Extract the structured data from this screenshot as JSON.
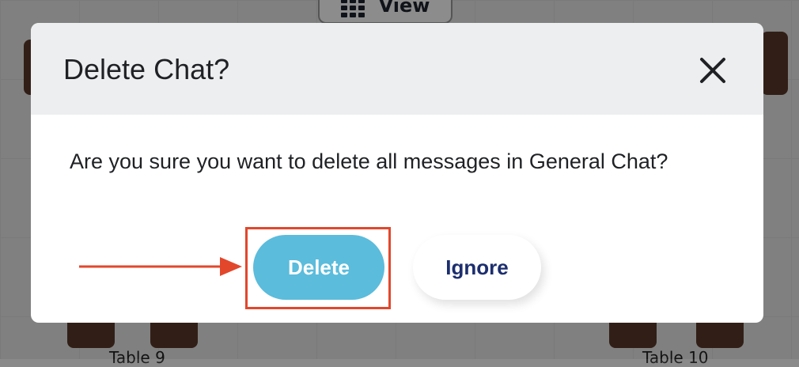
{
  "background": {
    "view_tab_label": "View",
    "table_labels": [
      "Table 9",
      "Table 10"
    ]
  },
  "dialog": {
    "title": "Delete Chat?",
    "close_icon": "close-icon",
    "message": "Are you sure you want to delete all messages in General Chat?",
    "delete_label": "Delete",
    "ignore_label": "Ignore"
  },
  "annotation": {
    "highlight_target": "delete-button",
    "arrow_icon": "arrow-right-icon",
    "color": "#e2472c"
  },
  "colors": {
    "delete_button": "#5bbcdc",
    "ignore_text": "#1c2e6e",
    "header_bg": "#edeef0"
  }
}
